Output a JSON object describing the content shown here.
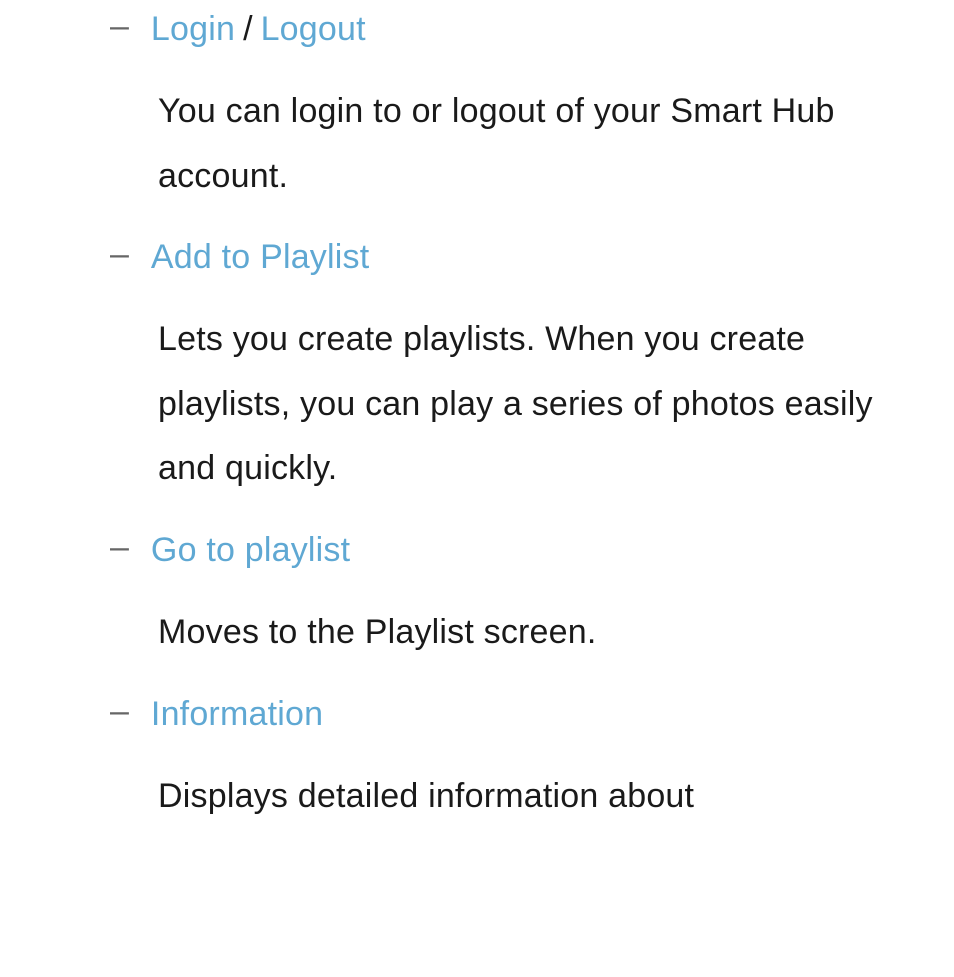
{
  "items": [
    {
      "links": [
        "Login",
        "Logout"
      ],
      "separator": " / ",
      "description": "You can login to or logout of your Smart Hub account."
    },
    {
      "links": [
        "Add to Playlist"
      ],
      "separator": "",
      "description": "Lets you create playlists. When you create playlists, you can play a series of photos easily and quickly."
    },
    {
      "links": [
        "Go to playlist"
      ],
      "separator": "",
      "description": "Moves to the Playlist screen."
    },
    {
      "links": [
        "Information"
      ],
      "separator": "",
      "description": "Displays detailed information about"
    }
  ],
  "dash": "–"
}
